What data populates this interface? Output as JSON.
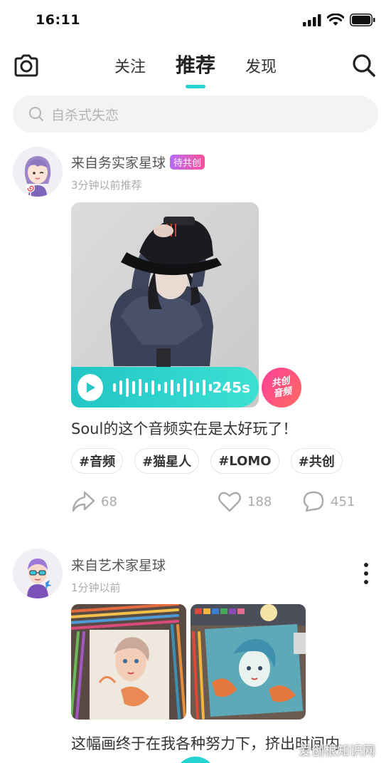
{
  "status": {
    "time": "16:11"
  },
  "header": {
    "tabs": [
      {
        "label": "关注"
      },
      {
        "label": "推荐",
        "active": true
      },
      {
        "label": "发现"
      }
    ]
  },
  "search": {
    "placeholder": "自杀式失恋"
  },
  "accent": "#25d4d0",
  "posts": [
    {
      "source": "来自务实家星球",
      "badge": "待共创",
      "time": "3分钟以前推荐",
      "audio_duration": "245s",
      "cocreate_label": [
        "共创",
        "音频"
      ],
      "text": "Soul的这个音频实在是太好玩了！",
      "tags": [
        "#音频",
        "#猫星人",
        "#LOMO",
        "#共创"
      ],
      "shares": "68",
      "likes": "188",
      "comments": "451"
    },
    {
      "source": "来自艺术家星球",
      "time": "1分钟以前",
      "text": "这幅画终于在我各种努力下，挤出时间内"
    }
  ],
  "watermark": "爱创根知识网"
}
